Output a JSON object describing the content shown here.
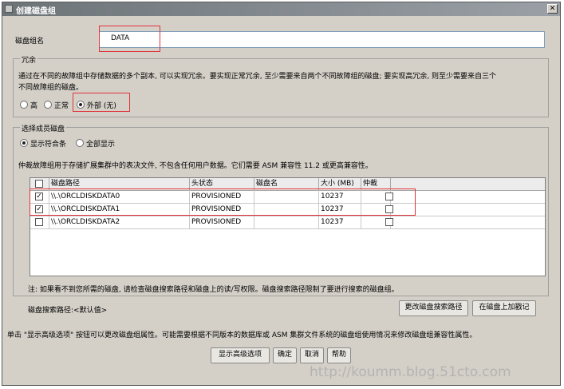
{
  "window": {
    "title": "创建磁盘组"
  },
  "disk_group_name": {
    "label": "磁盘组名",
    "value": "DATA"
  },
  "redundancy": {
    "title": "冗余",
    "description_line1": "通过在不同的故障组中存储数据的多个副本, 可以实现冗余。要实现正常冗余, 至少需要来自两个不同故障组的磁盘; 要实现高冗余, 则至少需要来自三个",
    "description_line2": "不同故障组的磁盘。",
    "options": [
      "高",
      "正常",
      "外部 (无)"
    ],
    "selected": "外部 (无)"
  },
  "member_disks": {
    "title": "选择成员磁盘",
    "options": [
      "显示符合条",
      "全部显示"
    ],
    "selected": "显示符合条",
    "info": "仲裁故障组用于存储扩展集群中的表决文件, 不包含任何用户数据。它们需要 ASM 兼容性 11.2 或更高兼容性。",
    "columns": [
      "磁盘路径",
      "头状态",
      "磁盘名",
      "大小 (MB)",
      "仲裁"
    ],
    "rows": [
      {
        "checked": true,
        "path": "\\\\.\\ORCLDISKDATA0",
        "status": "PROVISIONED",
        "name": "",
        "size": "10237",
        "quorum": false
      },
      {
        "checked": true,
        "path": "\\\\.\\ORCLDISKDATA1",
        "status": "PROVISIONED",
        "name": "",
        "size": "10237",
        "quorum": false
      },
      {
        "checked": false,
        "path": "\\\\.\\ORCLDISKDATA2",
        "status": "PROVISIONED",
        "name": "",
        "size": "10237",
        "quorum": false
      }
    ]
  },
  "note": "注: 如果看不到您所需的磁盘, 请检查磁盘搜索路径和磁盘上的读/写权限。磁盘搜索路径限制了要进行搜索的磁盘组。",
  "search_path_label": "磁盘搜索路径:<默认值>",
  "buttons": {
    "change_search_path": "更改磁盘搜索路径",
    "stamp_disk": "在磁盘上加戳记",
    "show_advanced": "显示高级选项",
    "ok": "确定",
    "cancel": "取消",
    "help": "帮助"
  },
  "bottom_hint": "单击 \"显示高级选项\" 按钮可以更改磁盘组属性。可能需要根据不同版本的数据库或 ASM 集群文件系统的磁盘组使用情况来修改磁盘组兼容性属性。",
  "watermark": "http://koumm.blog.51cto.com",
  "colors": {
    "title_bar": "#6d7478",
    "highlight": "#e0333a",
    "dialog_bg": "#d4d0c8"
  }
}
